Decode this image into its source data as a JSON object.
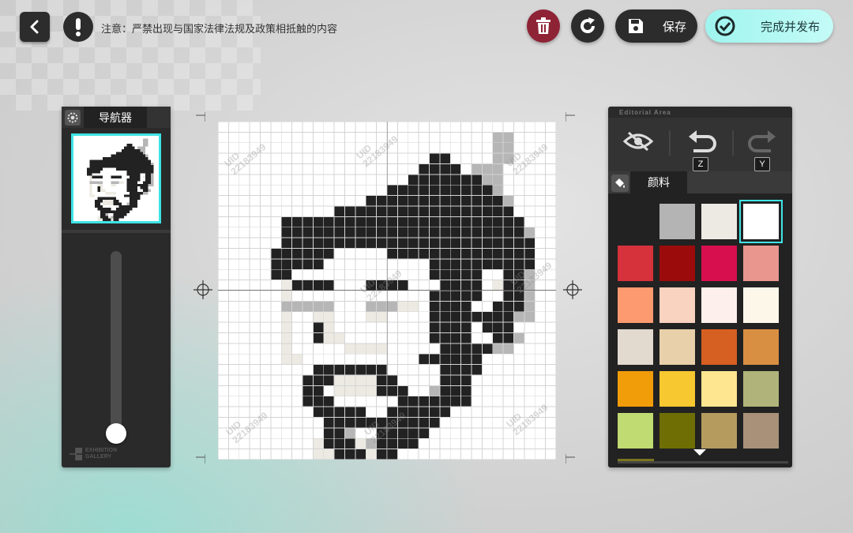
{
  "header": {
    "notice": "注意：严禁出现与国家法律法规及政策相抵触的内容",
    "save_label": "保存",
    "publish_label": "完成并发布",
    "icons": {
      "back": "chevron-left-icon",
      "alert": "exclamation-icon",
      "delete": "trash-icon",
      "redo": "rotate-icon",
      "save": "floppy-disk-icon",
      "publish": "check-circle-icon"
    }
  },
  "navigator": {
    "tab_label": "导航器",
    "brand": [
      "EXHIBITION",
      "GALLERY"
    ]
  },
  "canvas": {
    "grid_size": 32,
    "watermark": [
      "UID",
      "22183949"
    ],
    "palette_key": {
      "W": "#ffffff",
      "B": "#222222",
      "G": "#b6b6b6",
      "E": "#eceae2"
    },
    "rows": [
      "................................",
      "..........................GG....",
      "..........................GG....",
      "....................BB....GG....",
      "...................BBBB.GGG.....",
      "..................BBBBBBBGG.....",
      "................BBBBBBBBBBG.....",
      "..............BBBBBBBBBBBBBG....",
      "...........BBBBBBBBBBBBBBBBB....",
      "......BBBBBBBBBBBBBBBBBBBBBBB...",
      "......BBBBBBBBBBBBBBBBBBBBBBBG..",
      "......BBBBBBBBBBBBBBBBBBBBBBBB..",
      ".....BBBBBB.....BBBBBBBBBBBBBB..",
      ".....BBBBB..........BBBBBBBBBB..",
      ".....BB.............BBBBB..BBG..",
      "......EBBBB...BBBB...BBBB.EBBG..",
      "......E.............BBBBB..BBG..",
      "......GGGGG...GGGEE.BBBB..BBBG..",
      "......E..EE...EE....BBBBBBBBGG..",
      "......E..BE.........BBBB.BBB....",
      "......E..BEE........BBBB..BBG...",
      "......E.....EEEE.....BBBBBGG....",
      "......EE...........BBBBBB.......",
      ".........BBBBBBB.....BBBB.......",
      "........BBBEEEEBB....BBB........",
      "........BB.EEEEBBB..GBBB........",
      "........BBB......BBBBBBB........",
      ".........BBBBB..BBBBBB..........",
      "..........BBBBBBBBBBB...........",
      "..........BBG..BBBBB............",
      ".........EBBBEGBBBB.............",
      ".........EEBBBEBB..............."
    ]
  },
  "editor": {
    "header": "Editorial Area",
    "tools": [
      {
        "name": "toggle-visibility",
        "icon": "eye-slash-icon"
      },
      {
        "name": "undo",
        "icon": "undo-icon",
        "key": "Z"
      },
      {
        "name": "redo",
        "icon": "redo-icon",
        "key": "Y"
      }
    ],
    "pigment_tab_label": "颜料",
    "pigment_icon": "paint-bucket-icon",
    "selected_swatch": 3,
    "swatches": [
      "#222222",
      "#b4b4b4",
      "#eceae2",
      "#ffffff",
      "#d6323c",
      "#9c0b0b",
      "#d80f4e",
      "#e9968f",
      "#fe9a70",
      "#fad2c0",
      "#fcefec",
      "#fdf7ea",
      "#e2d9cf",
      "#e8d0aa",
      "#d65f22",
      "#d88f42",
      "#f19d09",
      "#f8c830",
      "#fde68f",
      "#b0b47b",
      "#bfdb71",
      "#6e6e05",
      "#b69b5e",
      "#a99179"
    ]
  }
}
